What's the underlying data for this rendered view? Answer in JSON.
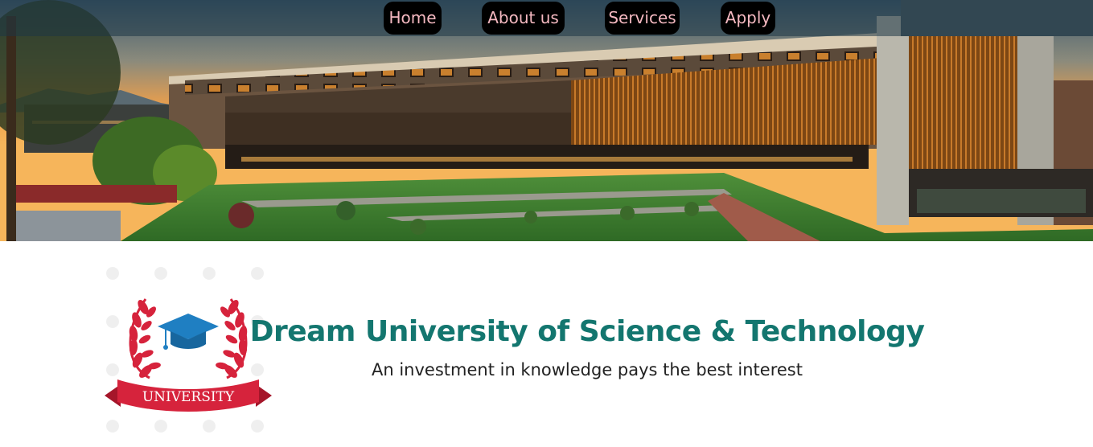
{
  "nav": {
    "items": [
      {
        "label": "Home"
      },
      {
        "label": "About us"
      },
      {
        "label": "Services"
      },
      {
        "label": "Apply"
      }
    ]
  },
  "hero": {
    "image": "campus-building-at-sunset"
  },
  "brand": {
    "logo_icon": "graduation-cap-laurel-icon",
    "logo_text": "UNIVERSITY",
    "title": "Dream University of Science & Technology",
    "tagline": "An investment in knowledge pays the best interest"
  },
  "colors": {
    "title": "#13766f",
    "nav_bg": "#000000",
    "nav_text": "#f4b8c0",
    "logo_red": "#d6233c",
    "logo_blue": "#1f7fc2"
  }
}
